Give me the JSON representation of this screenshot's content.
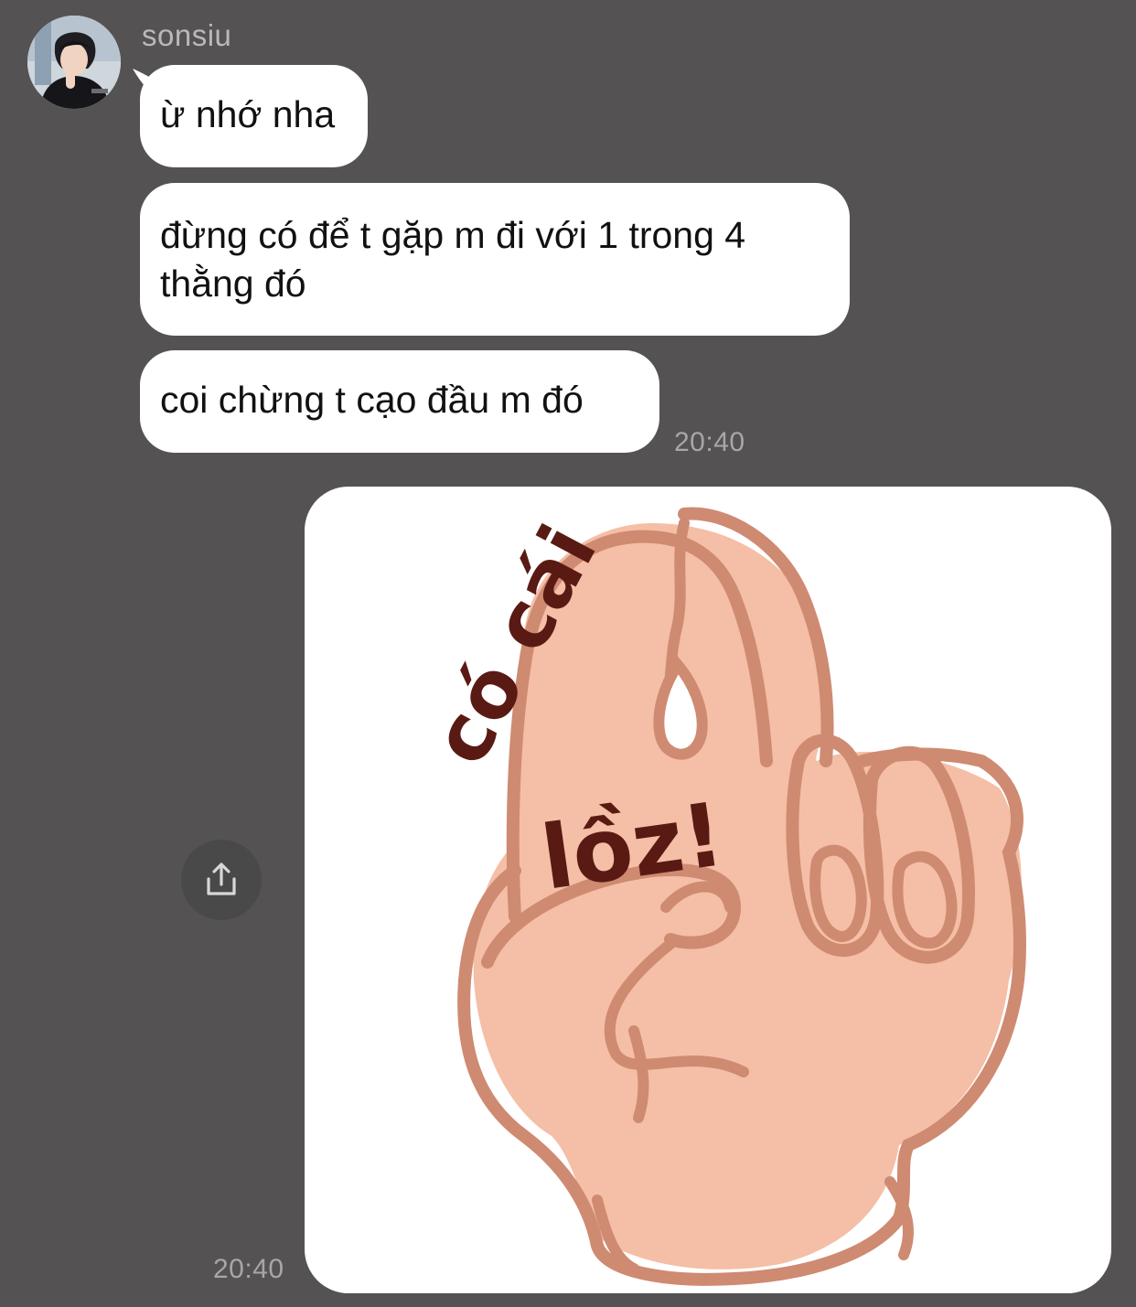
{
  "sender": {
    "name": "sonsiu",
    "avatar_icon": "user-avatar-photo"
  },
  "messages": [
    {
      "text": "ừ nhớ nha"
    },
    {
      "text": "đừng có để t gặp m đi với 1 trong 4 thằng đó"
    },
    {
      "text": "coi chừng t cạo đầu m đó"
    }
  ],
  "received_time": "20:40",
  "sticker": {
    "caption_top": "có cái",
    "caption_bottom": "lồz!",
    "icon": "hand-ok-sticker"
  },
  "sent_time": "20:40",
  "share_button": {
    "icon": "share-icon"
  },
  "colors": {
    "background": "#545253",
    "bubble": "#ffffff",
    "timestamp": "#a7a6a8",
    "sender_name": "#b9b9bb",
    "share_button": "#4a494a"
  }
}
